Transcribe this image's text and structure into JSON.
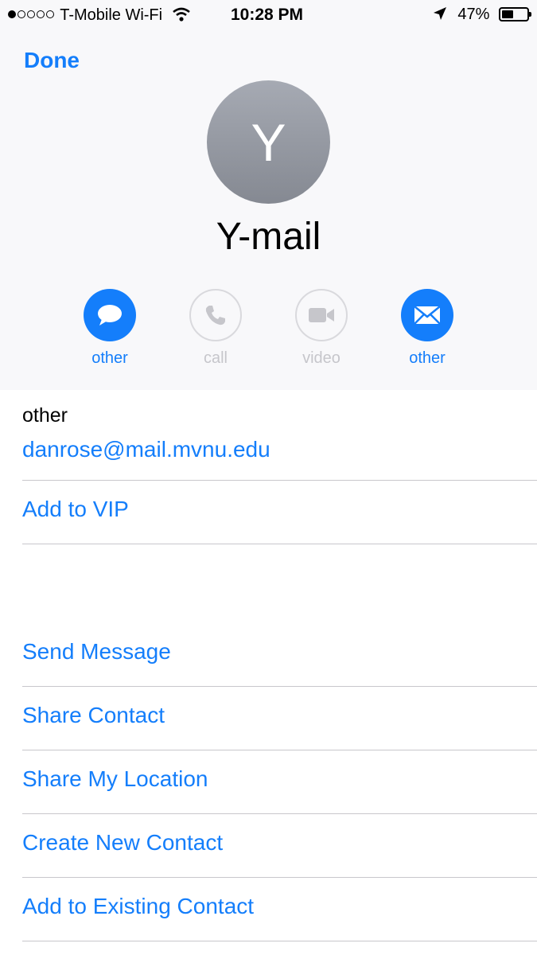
{
  "status_bar": {
    "carrier": "T-Mobile Wi-Fi",
    "time": "10:28 PM",
    "battery": "47%",
    "battery_level": 0.47
  },
  "nav": {
    "done_label": "Done"
  },
  "contact": {
    "initial": "Y",
    "name": "Y-mail"
  },
  "actions": [
    {
      "label": "other",
      "icon": "message-icon",
      "enabled": true
    },
    {
      "label": "call",
      "icon": "phone-icon",
      "enabled": false
    },
    {
      "label": "video",
      "icon": "video-icon",
      "enabled": false
    },
    {
      "label": "other",
      "icon": "mail-icon",
      "enabled": true
    }
  ],
  "email": {
    "type_label": "other",
    "address": "danrose@mail.mvnu.edu"
  },
  "vip_label": "Add to VIP",
  "menu": [
    "Send Message",
    "Share Contact",
    "Share My Location",
    "Create New Contact",
    "Add to Existing Contact"
  ],
  "colors": {
    "accent": "#147efb",
    "header_bg": "#f8f8fa",
    "separator": "#c8c7cc"
  }
}
